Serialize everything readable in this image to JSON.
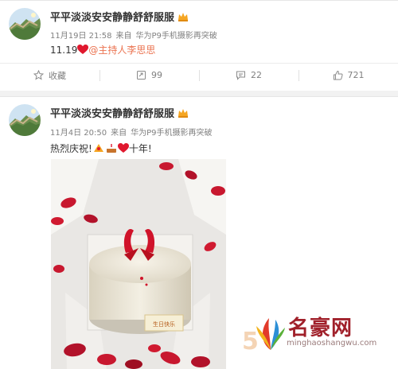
{
  "post1": {
    "username": "平平淡淡安安静静舒舒服服",
    "time": "11月19日 21:58",
    "source_prefix": "来自",
    "source": "华为P9手机摄影再突破",
    "content_date": "11.19",
    "mention": "@主持人李思思",
    "actions": {
      "favorite_label": "收藏",
      "repost_count": "99",
      "comment_count": "22",
      "like_count": "721"
    }
  },
  "post2": {
    "username": "平平淡淡安安静静舒舒服服",
    "time": "11月4日 20:50",
    "source_prefix": "来自",
    "source": "华为P9手机摄影再突破",
    "content_prefix": "热烈庆祝!",
    "content_suffix": "十年!",
    "cake_plaque": "生日快乐"
  },
  "watermark": {
    "brand": "名豪网",
    "domain": "minghaoshangwu.com",
    "number": "5"
  },
  "colors": {
    "mention": "#eb7350",
    "heart": "#e0182e",
    "vip_badge": "#f5a623",
    "muted": "#808080"
  }
}
